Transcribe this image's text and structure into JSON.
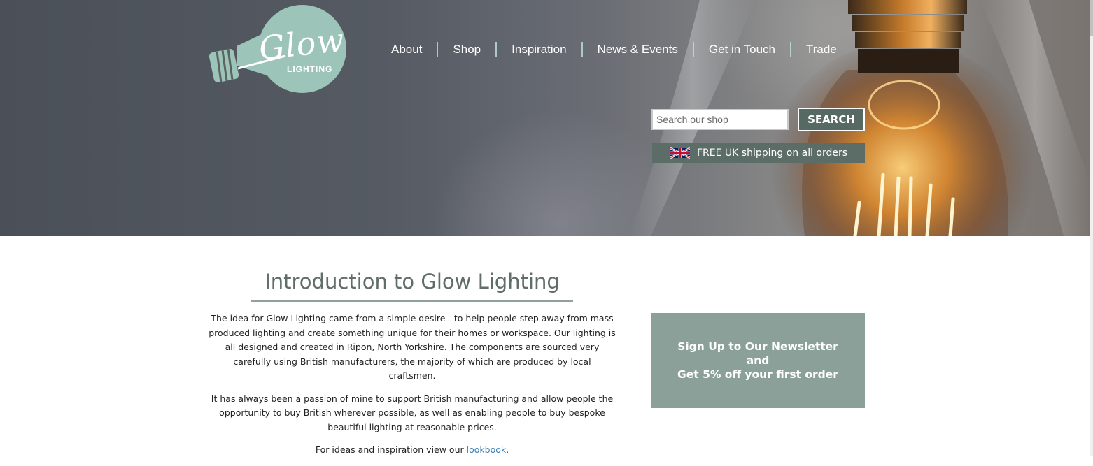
{
  "logo": {
    "word": "Glow",
    "sub": "LIGHTING"
  },
  "nav": {
    "items": [
      "About",
      "Shop",
      "Inspiration",
      "News & Events",
      "Get in Touch",
      "Trade"
    ]
  },
  "search": {
    "placeholder": "Search our shop",
    "value": "",
    "button_label": "SEARCH"
  },
  "shipping": {
    "text": "FREE UK shipping on all orders",
    "flag_icon": "uk-flag-icon"
  },
  "intro": {
    "title": "Introduction to Glow Lighting",
    "paragraph1": "The idea for Glow Lighting came from a simple desire - to help people step away from mass produced lighting and create something unique for their homes or workspace. Our lighting is all designed and created in Ripon, North Yorkshire. The components are sourced very carefully using British manufacturers, the majority of which are produced by local craftsmen.",
    "paragraph2": "It has always been a passion of mine to support British manufacturing and allow people the opportunity to buy British wherever possible, as well as enabling people to buy bespoke beautiful lighting at reasonable prices.",
    "paragraph3_prefix": "For ideas and inspiration view our ",
    "paragraph3_link": "lookbook",
    "paragraph3_suffix": "."
  },
  "newsletter": {
    "line1": "Sign Up to Our Newsletter",
    "line2": "and",
    "line3": "Get 5% off your first order"
  },
  "colors": {
    "brand_green": "#566a63",
    "logo_mint": "#9dc4b8",
    "newsletter_bg": "#8aa098",
    "link": "#3b7fb5"
  }
}
